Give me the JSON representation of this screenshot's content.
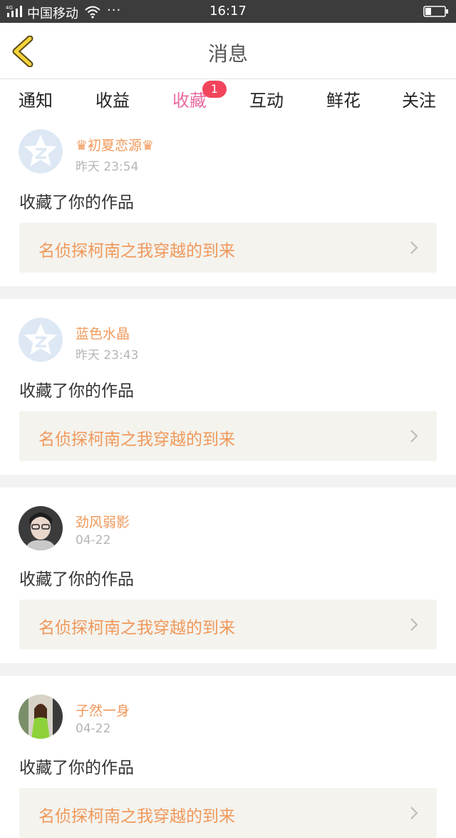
{
  "status_bar": {
    "network_type": "4G",
    "carrier": "中国移动",
    "more": "···",
    "time": "16:17"
  },
  "header": {
    "title": "消息"
  },
  "tabs": [
    {
      "label": "通知"
    },
    {
      "label": "收益"
    },
    {
      "label": "收藏",
      "active": true,
      "badge": "1"
    },
    {
      "label": "互动"
    },
    {
      "label": "鲜花"
    },
    {
      "label": "关注"
    }
  ],
  "colors": {
    "accent_pink": "#e96a9f",
    "username_orange": "#f0985a",
    "badge_red": "#f2455b",
    "link_bg": "#f4f3ee"
  },
  "messages": [
    {
      "username": "♛初夏恋源♛",
      "time": "昨天 23:54",
      "action": "收藏了你的作品",
      "work_title": "名侦探柯南之我穿越的到来",
      "avatar": "default-star-avatar"
    },
    {
      "username": "蓝色水晶",
      "time": "昨天 23:43",
      "action": "收藏了你的作品",
      "work_title": "名侦探柯南之我穿越的到来",
      "avatar": "default-star-avatar"
    },
    {
      "username": "劲风弱影",
      "time": "04-22",
      "action": "收藏了你的作品",
      "work_title": "名侦探柯南之我穿越的到来",
      "avatar": "photo-avatar"
    },
    {
      "username": "子然一身",
      "time": "04-22",
      "action": "收藏了你的作品",
      "work_title": "名侦探柯南之我穿越的到来",
      "avatar": "photo-avatar"
    }
  ]
}
